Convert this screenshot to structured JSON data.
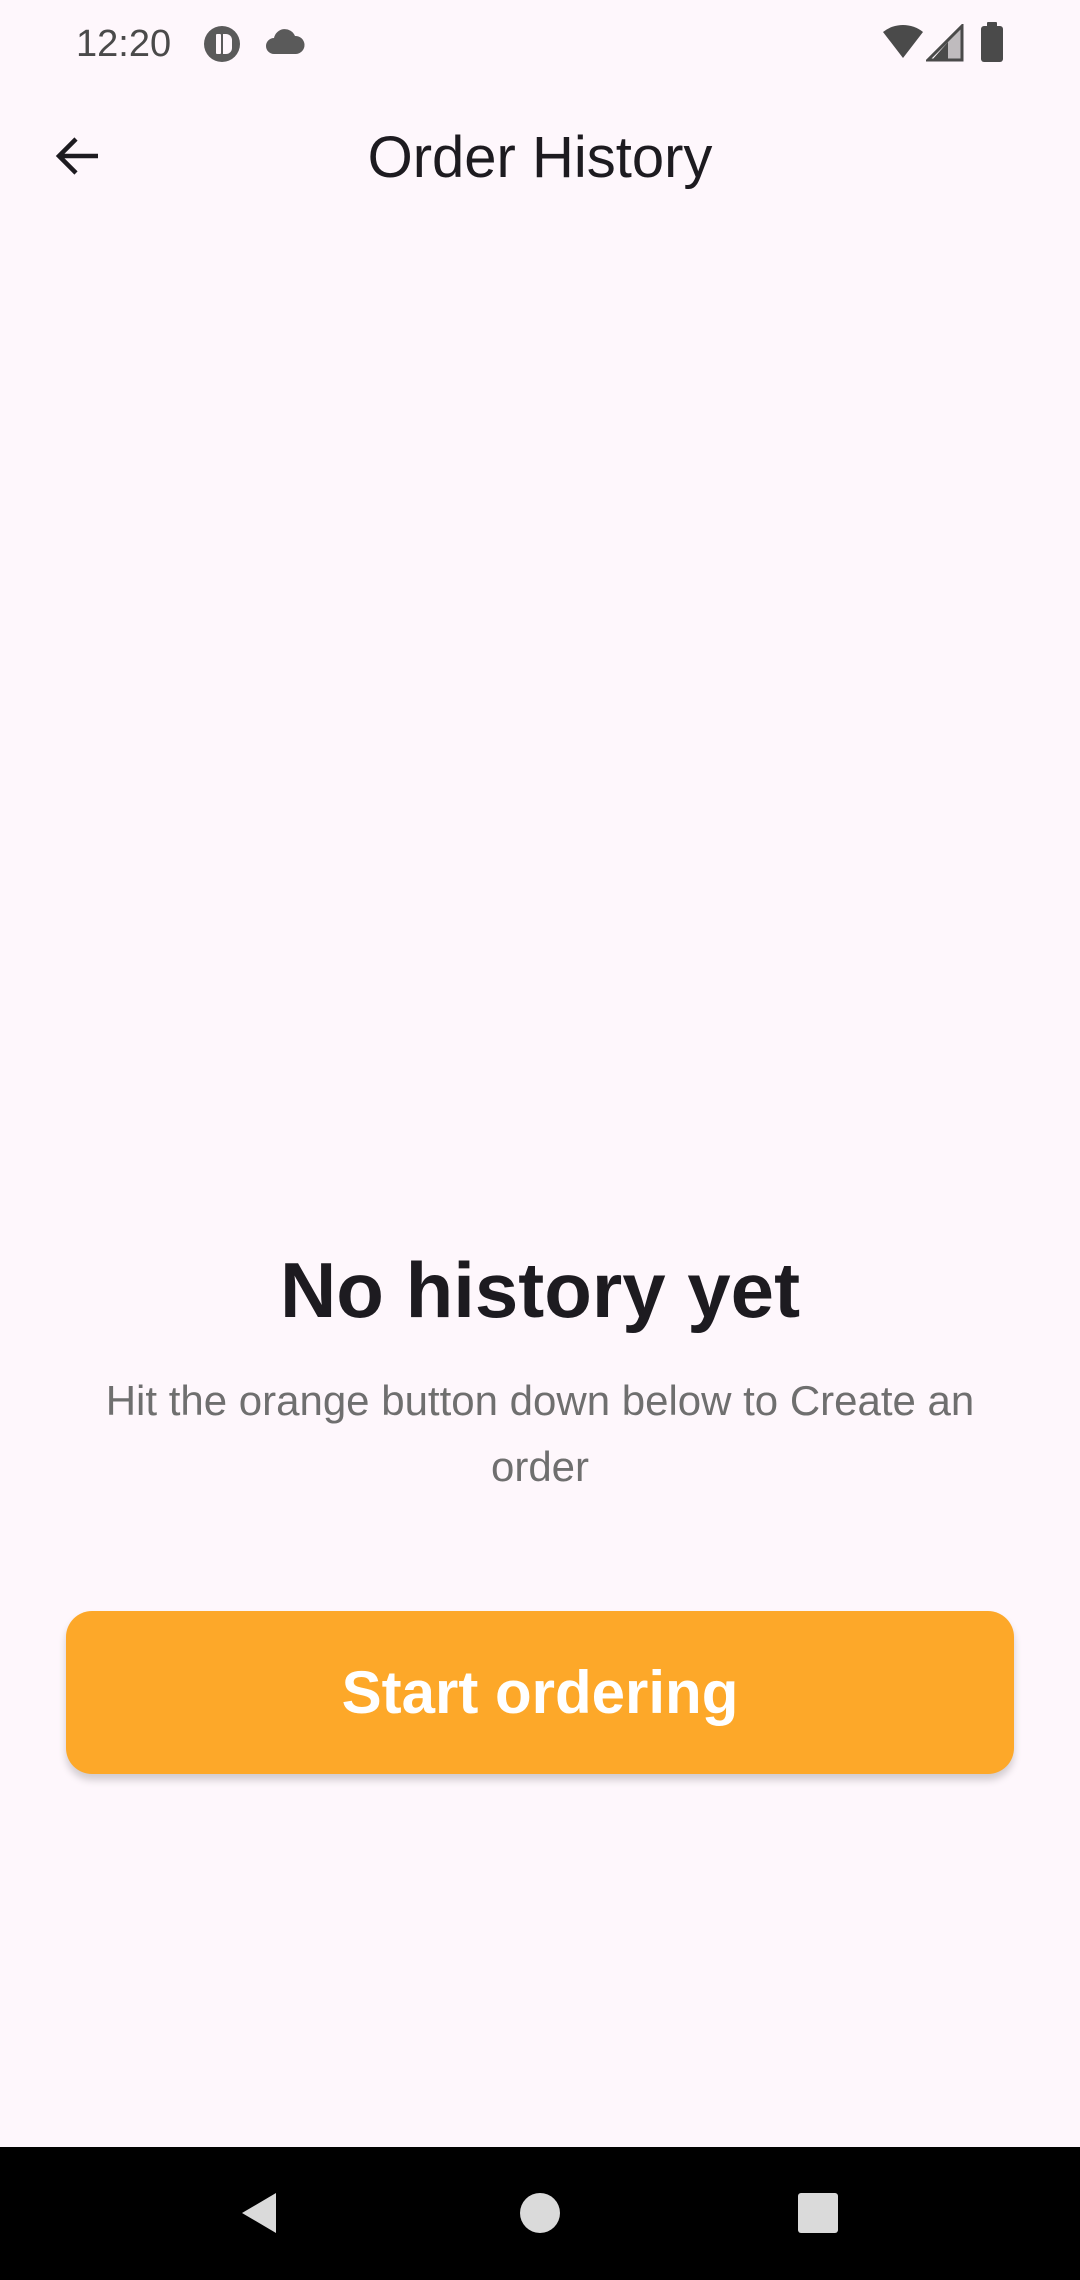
{
  "status_bar": {
    "time": "12:20",
    "icons": [
      "app-notification-icon",
      "cloud-icon",
      "wifi-icon",
      "cellular-signal-icon",
      "battery-icon"
    ]
  },
  "app_bar": {
    "title": "Order History",
    "back_icon": "arrow-left-icon"
  },
  "empty_state": {
    "title": "No history yet",
    "subtitle": "Hit the orange button down below to Create an order"
  },
  "action": {
    "start_label": "Start ordering",
    "color": "#FDA829"
  },
  "nav_bar": {
    "icons": [
      "back-triangle-icon",
      "home-circle-icon",
      "recents-square-icon"
    ]
  },
  "colors": {
    "background": "#FEF7FC",
    "accent": "#FDA829",
    "title_text": "#1D1B20",
    "subtitle_text": "#6F6F6F"
  }
}
